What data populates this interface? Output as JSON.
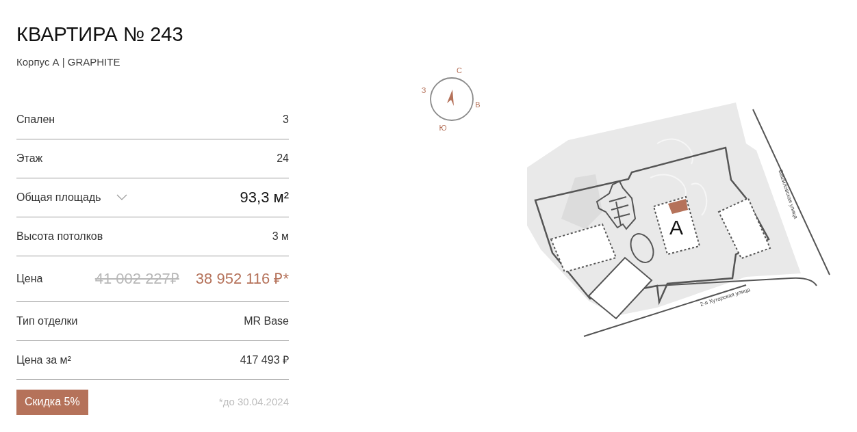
{
  "title": "КВАРТИРА № 243",
  "subtitle": "Корпус А | GRAPHITE",
  "specs": [
    {
      "kind": "plain",
      "label": "Спален",
      "value": "3"
    },
    {
      "kind": "plain",
      "label": "Этаж",
      "value": "24"
    },
    {
      "kind": "area",
      "label": "Общая площадь",
      "value": "93,3 м²",
      "expanded": false
    },
    {
      "kind": "plain",
      "label": "Высота потолков",
      "value": "3 м"
    },
    {
      "kind": "price",
      "label": "Цена",
      "old_value": "41 002 227₽",
      "value": "38 952 116 ₽*"
    },
    {
      "kind": "plain",
      "label": "Тип отделки",
      "value": "MR Base"
    },
    {
      "kind": "plain",
      "label": "Цена за м²",
      "value": "417 493 ₽"
    }
  ],
  "discount": {
    "label": "Скидка 5%",
    "note": "*до 30.04.2024"
  },
  "compass": [
    {
      "kind": "n",
      "label": "С"
    },
    {
      "kind": "e",
      "label": "В"
    },
    {
      "kind": "s",
      "label": "Ю"
    },
    {
      "kind": "w",
      "label": "З"
    }
  ],
  "site_plan": {
    "building_label": "А",
    "streets": [
      {
        "kind": "east",
        "name": "Башиловская улица"
      },
      {
        "kind": "south",
        "name": "2-я Хуторская улица"
      }
    ]
  }
}
